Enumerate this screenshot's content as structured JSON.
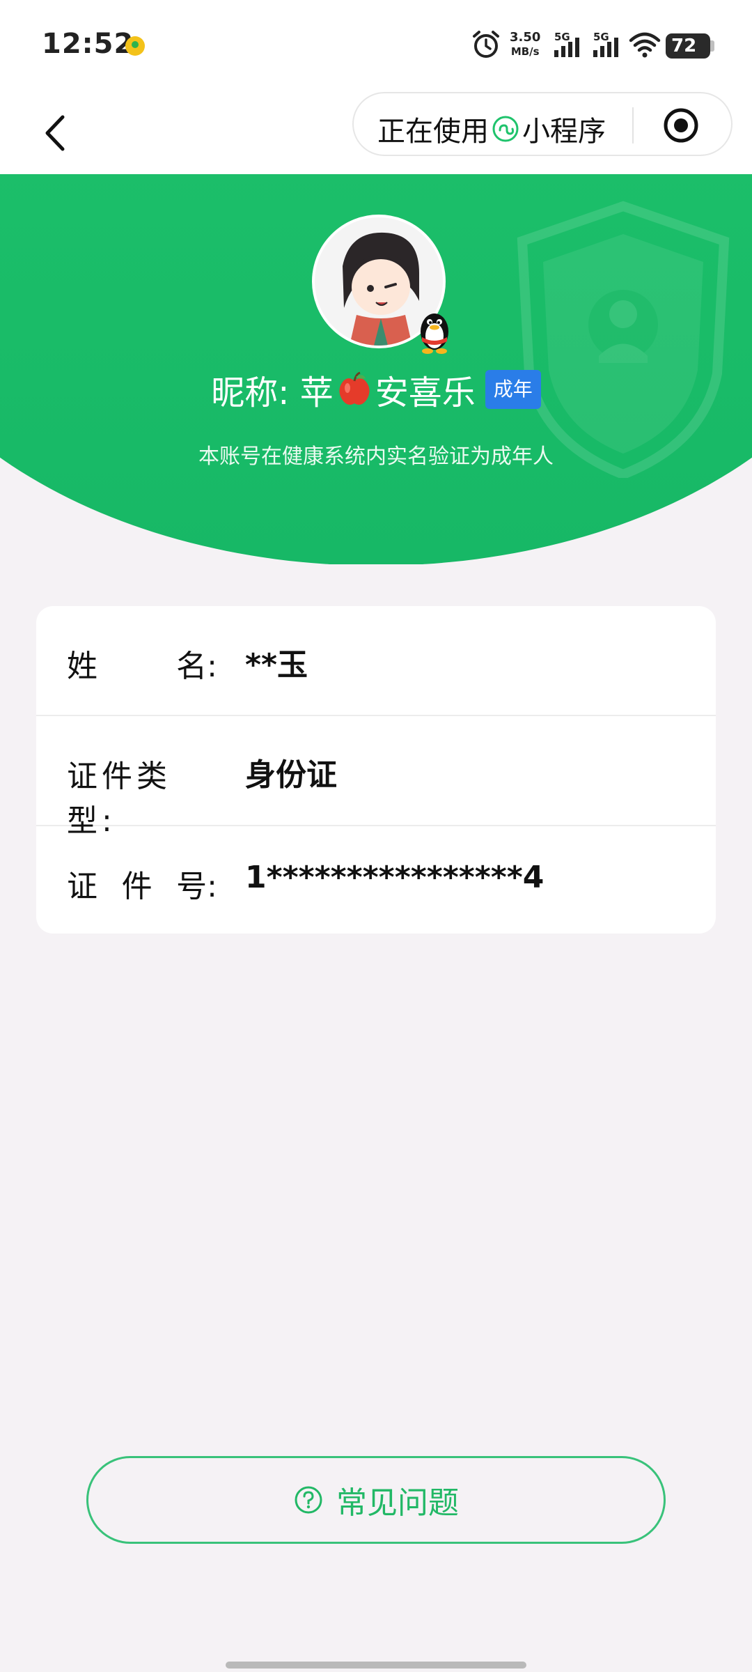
{
  "status_bar": {
    "time": "12:52",
    "net_speed_value": "3.50",
    "net_speed_unit": "MB/s",
    "signal_1_label": "5G",
    "signal_2_label": "5G",
    "battery": "72"
  },
  "nav": {
    "capsule_text_before": "正在使用",
    "capsule_text_after": "小程序"
  },
  "profile": {
    "nickname_prefix": "昵称: 苹",
    "nickname_suffix": "安喜乐",
    "badge": "成年",
    "description": "本账号在健康系统内实名验证为成年人"
  },
  "info": {
    "rows": [
      {
        "label_chars": [
          "姓",
          "名:"
        ],
        "value": "**玉"
      },
      {
        "label_chars": [
          "证件类型:"
        ],
        "value": "身份证"
      },
      {
        "label_chars": [
          "证",
          "件",
          "号:"
        ],
        "value": "1****************4"
      }
    ]
  },
  "faq": {
    "label": "常见问题"
  },
  "colors": {
    "primary_green": "#1fc36c",
    "badge_blue": "#2a7de8",
    "background": "#f5f2f5"
  }
}
